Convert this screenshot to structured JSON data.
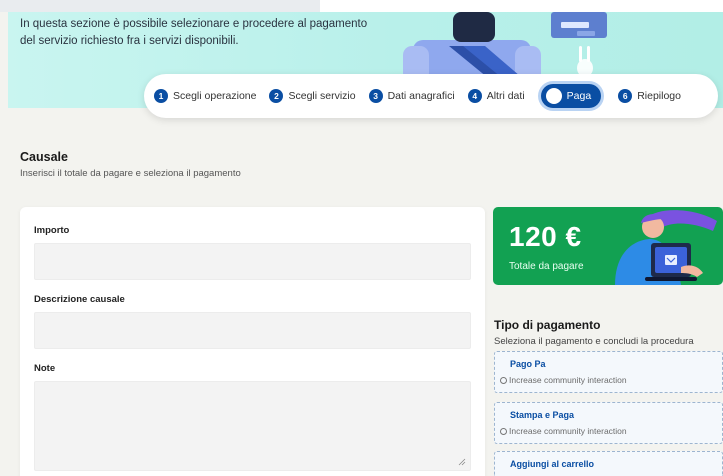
{
  "hero": {
    "line1": "In questa sezione è possibile selezionare e procedere al pagamento",
    "line2": "del servizio richiesto fra i servizi disponibili."
  },
  "stepper": {
    "steps": [
      {
        "num": "1",
        "label": "Scegli operazione"
      },
      {
        "num": "2",
        "label": "Scegli servizio"
      },
      {
        "num": "3",
        "label": "Dati anagrafici"
      },
      {
        "num": "4",
        "label": "Altri dati"
      },
      {
        "num": "",
        "label": "Paga"
      },
      {
        "num": "6",
        "label": "Riepilogo"
      }
    ],
    "active_step": "Paga"
  },
  "causale": {
    "title": "Causale",
    "subtitle": "Inserisci il totale da pagare e seleziona il pagamento"
  },
  "form": {
    "importo_label": "Importo",
    "importo_value": "",
    "descrizione_label": "Descrizione causale",
    "descrizione_value": "",
    "note_label": "Note",
    "note_value": ""
  },
  "total": {
    "amount": "120 €",
    "label": "Totale da pagare"
  },
  "payment": {
    "title": "Tipo di pagamento",
    "subtitle": "Seleziona il pagamento e concludi la procedura",
    "options": [
      {
        "title": "Pago Pa",
        "radio_label": "Increase community interaction"
      },
      {
        "title": "Stampa e Paga",
        "radio_label": "Increase community interaction"
      },
      {
        "title": "Aggiungi al carrello",
        "radio_label": ""
      }
    ]
  },
  "colors": {
    "primary": "#0a4ea3",
    "hero_bg": "#b8f0ea",
    "total_bg": "#12a152",
    "page_bg": "#f3f3ef"
  }
}
